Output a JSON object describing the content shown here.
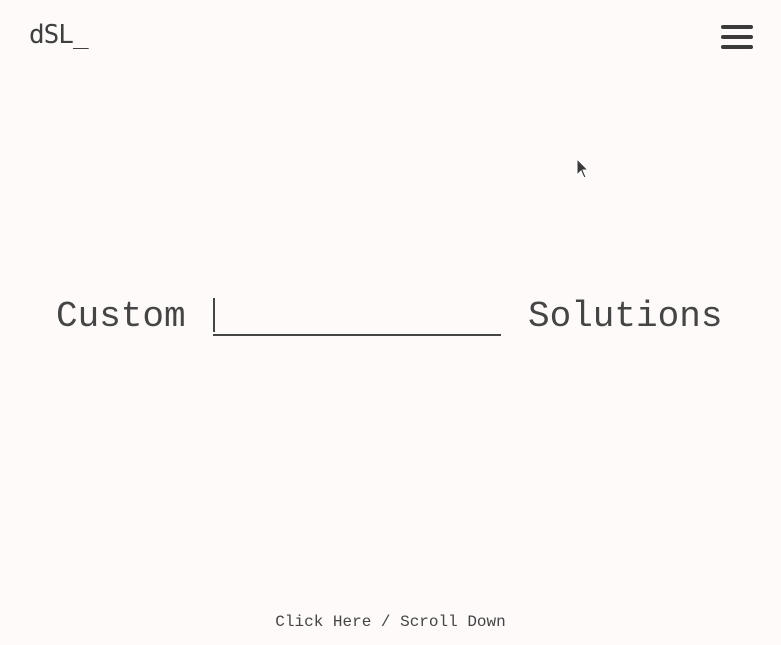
{
  "header": {
    "logo_text": "dSL_",
    "menu_icon": "hamburger-menu-icon"
  },
  "hero": {
    "word_before": "Custom",
    "typed_value": "",
    "word_after": "Solutions"
  },
  "footer": {
    "cta_label": "Click Here / Scroll Down"
  },
  "cursor": {
    "icon": "mouse-pointer-icon"
  },
  "colors": {
    "background": "#fdfaf9",
    "text": "#454545"
  }
}
